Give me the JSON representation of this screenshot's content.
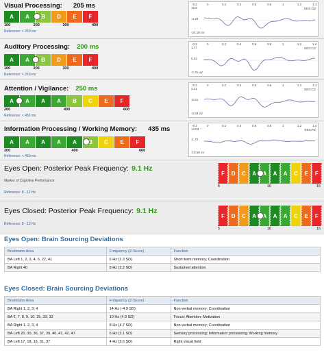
{
  "colors": {
    "dark_green": "#1e8a22",
    "mid_green": "#3aa832",
    "light_green": "#8cc63e",
    "yellow": "#f0d20a",
    "orange": "#f29a1a",
    "dark_orange": "#ee6b1e",
    "red": "#e8262a",
    "accent_value": "#2a9a12",
    "section_blue": "#2e6fa8"
  },
  "visual": {
    "label": "Visual Processing:",
    "value": "205 ms",
    "grades": [
      "A",
      "A",
      "B",
      "D",
      "E",
      "F"
    ],
    "ticks": [
      "100",
      "200",
      "300",
      "400"
    ],
    "reference": "Reference: < 250 ms",
    "marker_level": 0.35,
    "wave": {
      "t1": "-0.2",
      "t2": "0",
      "t3": "0.2",
      "t4": "0.4",
      "t5": "0.6",
      "t6": "0.8",
      "t7": "1",
      "t8": "1.2",
      "t9": "1.4",
      "y_top": "15.8",
      "y_mid": "-4.28",
      "y_bot": "-24.18 uV",
      "channel": "EEG:OZ"
    }
  },
  "auditory": {
    "label": "Auditory Processing:",
    "value": "200 ms",
    "grades": [
      "A",
      "A",
      "B",
      "D",
      "E",
      "F"
    ],
    "ticks": [
      "100",
      "200",
      "300",
      "400"
    ],
    "reference": "Reference: < 250 ms",
    "marker_level": 0.33,
    "wave": {
      "t1": "-0.2",
      "t2": "0",
      "t3": "0.2",
      "t4": "0.4",
      "t5": "0.6",
      "t6": "0.8",
      "t7": "1",
      "t8": "1.2",
      "t9": "1.4",
      "y_top": "1.77",
      "y_mid": "0.23",
      "y_bot": "-1.31 uV",
      "channel": "EEG:CZ"
    }
  },
  "attention": {
    "label": "Attention / Vigilance:",
    "value": "250 ms",
    "grades": [
      "A",
      "A",
      "A",
      "A",
      "B",
      "C",
      "E",
      "F"
    ],
    "ticks": [
      "200",
      "400",
      "600"
    ],
    "reference": "Reference: < 450 ms",
    "marker_level": 0.12,
    "wave": {
      "t1": "-0.2",
      "t2": "0",
      "t3": "0.2",
      "t4": "0.4",
      "t5": "0.6",
      "t6": "0.8",
      "t7": "1",
      "t8": "1.2",
      "t9": "1.4",
      "y_top": "2.41",
      "y_mid": "-0.61",
      "y_bot": "-3.63 uV",
      "channel": "EEG:CZ"
    }
  },
  "info": {
    "label": "Information Processing / Working Memory:",
    "value": "435 ms",
    "grades": [
      "A",
      "A",
      "A",
      "A",
      "A",
      "B",
      "C",
      "E",
      "F"
    ],
    "ticks": [
      "200",
      "400",
      "600"
    ],
    "reference": "Reference: < 450 ms",
    "marker_level": 0.58,
    "wave": {
      "t1": "-0.2",
      "t2": "0",
      "t3": "0.2",
      "t4": "0.4",
      "t5": "0.6",
      "t6": "0.8",
      "t7": "1",
      "t8": "1.2",
      "t9": "1.4",
      "y_top": "14.03",
      "y_mid": "-1.72",
      "y_bot": "-10.58 uV",
      "channel": "EEG:PZ"
    }
  },
  "eyes_open_peak": {
    "label": "Eyes Open: Posterior Peak Frequency:",
    "value": "9.1 Hz",
    "subtitle": "Marker of Cognitive Performance",
    "reference": "Reference: 8 - 12 Hz",
    "grades": [
      "F",
      "D",
      "C",
      "A",
      "A",
      "A",
      "A",
      "C",
      "E",
      "F"
    ],
    "ticks": [
      "5",
      "10",
      "15"
    ],
    "marker_level": 0.41
  },
  "eyes_closed_peak": {
    "label": "Eyes Closed: Posterior Peak Frequency:",
    "value": "9.1 Hz",
    "reference": "Reference: 8 - 12 Hz",
    "grades": [
      "F",
      "D",
      "C",
      "A",
      "A",
      "A",
      "A",
      "C",
      "E",
      "F"
    ],
    "ticks": [
      "5",
      "10",
      "15"
    ],
    "marker_level": 0.41
  },
  "eyes_open_table": {
    "title": "Eyes Open: Brain Sourcing Deviations",
    "headers": [
      "Brodmann Area",
      "Frequency (Z-Score)",
      "Function"
    ],
    "rows": [
      [
        "BA Left 1, 2, 3, 4, 6, 22, 41",
        "6 Hz (2.3 SD)",
        "Short-term memory; Coordination"
      ],
      [
        "BA Right 40",
        "8 Hz (2.2 SD)",
        "Sustained attention"
      ]
    ]
  },
  "eyes_closed_table": {
    "title": "Eyes Closed: Brain Sourcing Deviations",
    "headers": [
      "Brodmann Area",
      "Frequency (Z-Score)",
      "Function"
    ],
    "rows": [
      [
        "BA Right 1, 2, 3, 4",
        "14 Hz (-4.9 SD)",
        "Non-verbal memory; Coordination"
      ],
      [
        "BA 6, 7, 8, 9, 10, 25, 33, 32",
        "10 Hz (4.9 SD)",
        "Focus; Attention; Motivation"
      ],
      [
        "BA Right 1, 2, 3, 4",
        "8 Hz (4.7 SD)",
        "Non-verbal memory; Coordination"
      ],
      [
        "BA Left 20, 30, 36, 37, 39, 40, 41, 42, 47",
        "6 Hz (3.1 SD)",
        "Sensory processing; Information processing; Working memory"
      ],
      [
        "BA Left 17, 18, 19, 31, 37",
        "4 Hz (2.6 SD)",
        "Right visual field"
      ]
    ]
  }
}
